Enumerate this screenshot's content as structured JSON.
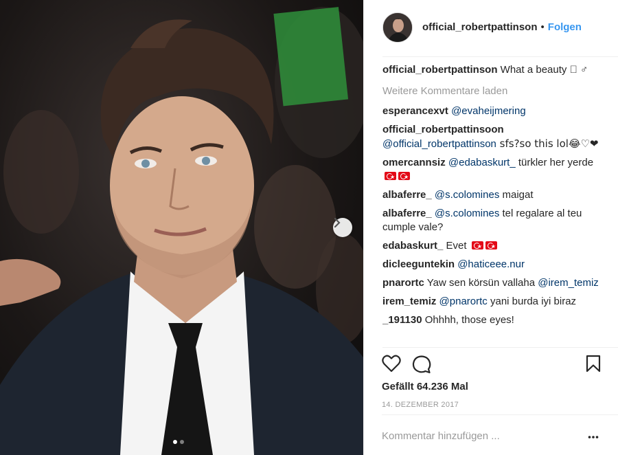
{
  "post": {
    "photo_alt": "",
    "carousel": {
      "total": 2,
      "current": 1
    }
  },
  "header": {
    "username": "official_robertpattinson",
    "separator": "•",
    "follow_label": "Folgen"
  },
  "caption": {
    "user": "official_robertpattinson",
    "text": " What a beauty 🏾 ♂"
  },
  "load_more_label": "Weitere Kommentare laden",
  "comments": [
    {
      "user": "esperancexvt",
      "mention": "@evaheijmering",
      "text": ""
    },
    {
      "user": "official_robertpattinsoon",
      "mention": "@official_robertpattinson",
      "text": " sfs?so this lol😂♡❤"
    },
    {
      "user": "omercannsiz",
      "mention": "@edabaskurt_",
      "text": " türkler her yerde"
    },
    {
      "user": "albaferre_",
      "mention": "@s.colomines",
      "text": " maigat"
    },
    {
      "user": "albaferre_",
      "mention": "@s.colomines",
      "text": " tel regalare al teu cumple vale?"
    },
    {
      "user": "edabaskurt_",
      "mention": "",
      "text": " Evet"
    },
    {
      "user": "dicleeguntekin",
      "mention": "@haticeee.nur",
      "text": ""
    },
    {
      "user": "pnarortc",
      "mention": "",
      "text": " Yaw sen körsün vallaha",
      "mention_after": "@irem_temiz"
    },
    {
      "user": "irem_temiz",
      "mention": "@pnarortc",
      "text": " yani burda iyi biraz"
    },
    {
      "user": "_191130",
      "mention": "",
      "text": " Ohhhh, those eyes!"
    }
  ],
  "likes_label": "Gefällt 64.236 Mal",
  "date_label": "14. DEZEMBER 2017",
  "comment_input": {
    "placeholder": "Kommentar hinzufügen ...",
    "value": ""
  },
  "icons": {
    "like": "heart-icon",
    "comment": "comment-bubble-icon",
    "save": "bookmark-icon",
    "next": "chevron-right-icon",
    "more": "more-options-icon"
  },
  "colors": {
    "link": "#3897f0",
    "mention": "#003569",
    "muted": "#999999",
    "text": "#262626"
  }
}
